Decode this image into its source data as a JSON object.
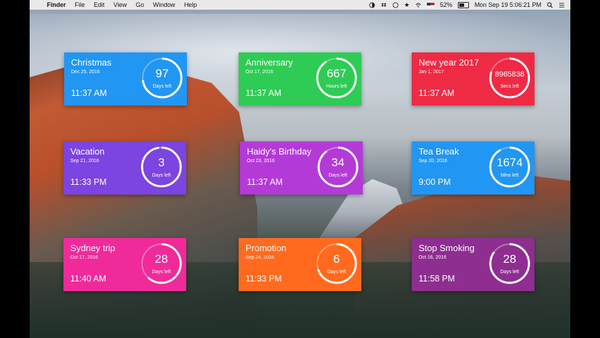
{
  "menubar": {
    "app": "Finder",
    "menus": [
      "File",
      "Edit",
      "View",
      "Go",
      "Window",
      "Help"
    ],
    "battery": "52%",
    "clock": "Mon Sep 19  5:06:21 PM"
  },
  "cards": [
    {
      "title": "Christmas",
      "date": "Dec 25, 2016",
      "time": "11:37 AM",
      "value": "97",
      "unit": "Days left",
      "color": "#2196f3",
      "progress": 0.73
    },
    {
      "title": "Anniversary",
      "date": "Oct 17, 2016",
      "time": "11:37 AM",
      "value": "667",
      "unit": "Hours left",
      "color": "#2ecc55",
      "progress": 0.91
    },
    {
      "title": "New year 2017",
      "date": "Jan 1, 2017",
      "time": "11:37 AM",
      "value": "8965838",
      "unit": "Secs left",
      "color": "#ef2a45",
      "progress": 0.8
    },
    {
      "title": "Vacation",
      "date": "Sep 21, 2016",
      "time": "11:33 PM",
      "value": "3",
      "unit": "Days left",
      "color": "#7c44e0",
      "progress": 0.98
    },
    {
      "title": "Haidy's Birthday",
      "date": "Oct 23, 2016",
      "time": "11:37 AM",
      "value": "34",
      "unit": "Days left",
      "color": "#b43ad8",
      "progress": 0.9
    },
    {
      "title": "Tea Break",
      "date": "Sep 20, 2016",
      "time": "9:00 PM",
      "value": "1674",
      "unit": "Mins left",
      "color": "#2196f3",
      "progress": 0.92
    },
    {
      "title": "Sydney trip",
      "date": "Oct 17, 2016",
      "time": "11:40 AM",
      "value": "28",
      "unit": "Days left",
      "color": "#f02a9a",
      "progress": 0.62
    },
    {
      "title": "Promotion",
      "date": "Sep 24, 2016",
      "time": "11:33 PM",
      "value": "6",
      "unit": "Days left",
      "color": "#ff6a1f",
      "progress": 0.7
    },
    {
      "title": "Stop Smoking",
      "date": "Oct 16, 2016",
      "time": "11:58 PM",
      "value": "28",
      "unit": "Days left",
      "color": "#8e2e90",
      "progress": 0.85
    }
  ]
}
